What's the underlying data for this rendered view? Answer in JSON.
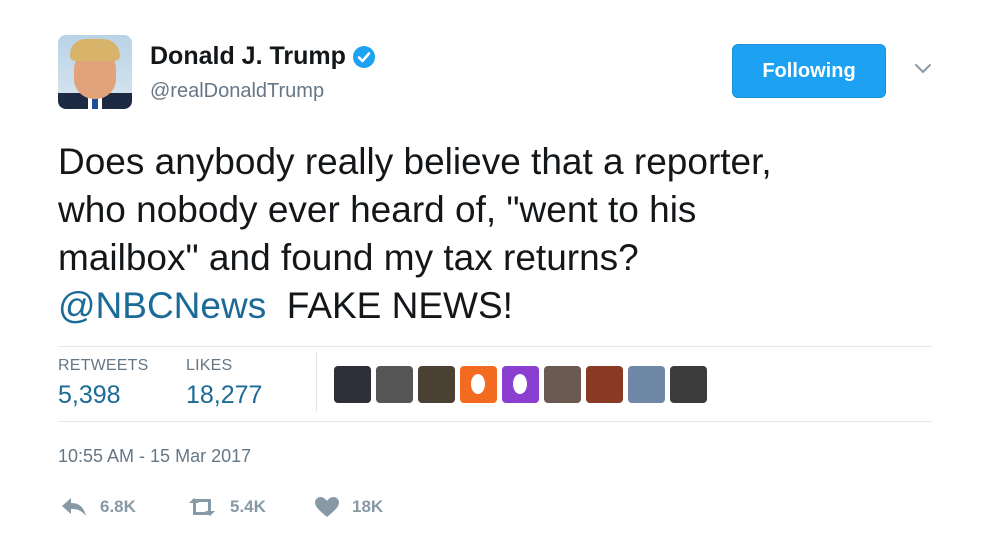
{
  "author": {
    "display_name": "Donald J. Trump",
    "handle": "@realDonaldTrump",
    "verified_icon": "verified-badge-icon",
    "verified_color": "#1da1f2"
  },
  "follow_button": {
    "label": "Following",
    "color": "#1da1f2"
  },
  "menu_icon": "chevron-down-icon",
  "tweet": {
    "lines": [
      "Does anybody really believe that a reporter,",
      "who nobody ever heard of, \"went to his",
      "mailbox\" and found my tax returns?"
    ],
    "mention": "@NBCNews",
    "tail": "FAKE NEWS!",
    "mention_color": "#1b6a97"
  },
  "stats": {
    "retweets": {
      "label": "RETWEETS",
      "value": "5,398"
    },
    "likes": {
      "label": "LIKES",
      "value": "18,277"
    }
  },
  "liker_avatars": [
    {
      "name": "liker-avatar-1",
      "color": "#2f2f3a"
    },
    {
      "name": "liker-avatar-2",
      "color": "#555555"
    },
    {
      "name": "liker-avatar-3",
      "color": "#4a4034"
    },
    {
      "name": "liker-avatar-4",
      "color": "#f36b21"
    },
    {
      "name": "liker-avatar-5",
      "color": "#8a3fd1"
    },
    {
      "name": "liker-avatar-6",
      "color": "#6b5a52"
    },
    {
      "name": "liker-avatar-7",
      "color": "#8a3a24"
    },
    {
      "name": "liker-avatar-8",
      "color": "#6f88a8"
    },
    {
      "name": "liker-avatar-9",
      "color": "#3b3b3b"
    }
  ],
  "timestamp": "10:55 AM - 15 Mar 2017",
  "actions": {
    "reply": {
      "icon": "reply-icon",
      "count": "6.8K"
    },
    "retweet": {
      "icon": "retweet-icon",
      "count": "5.4K"
    },
    "like": {
      "icon": "heart-icon",
      "count": "18K"
    }
  }
}
